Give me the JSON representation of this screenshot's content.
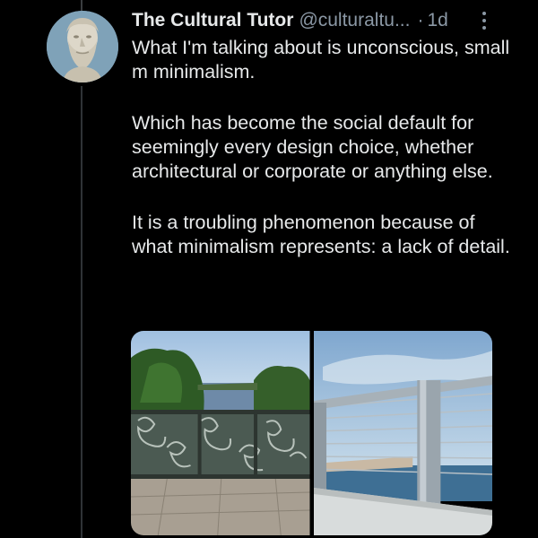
{
  "author": {
    "name": "The Cultural Tutor",
    "handle": "@culturaltu...",
    "separator": "·",
    "time": "1d"
  },
  "tweet": {
    "paragraphs": [
      "What I'm talking about is unconscious, small m minimalism.",
      "Which has become the social default for seemingly every design choice, whether architectural or corporate or anything else.",
      "It is a troubling phenomenon because of what minimalism represents: a lack of detail."
    ]
  },
  "icons": {
    "avatar": "bust-statue-avatar",
    "more": "more-options-icon"
  },
  "media": [
    {
      "name": "ornate-iron-railing-photo"
    },
    {
      "name": "minimal-steel-railing-photo"
    }
  ],
  "colors": {
    "background": "#000000",
    "text": "#e7e9ea",
    "muted": "#8b98a5"
  }
}
